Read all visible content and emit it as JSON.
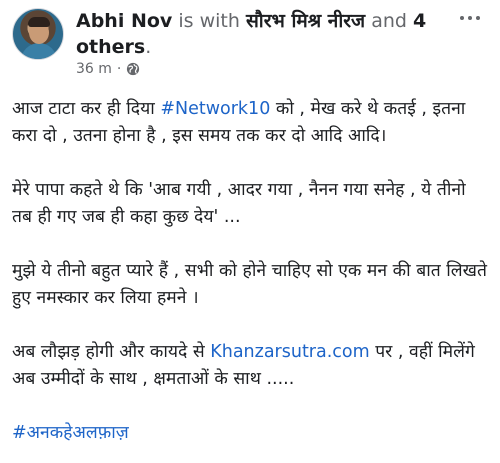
{
  "post": {
    "author": "Abhi Nov",
    "with_text": "is with",
    "tagged_person": "सौरभ मिश्र नीरज",
    "and_text": "and",
    "others": "4 others",
    "period": ".",
    "time": "36 m",
    "dot": "·",
    "privacy_icon": "globe-icon",
    "more_icon": "more-options-icon"
  },
  "body": {
    "p1_a": "आज टाटा कर ही दिया ",
    "p1_hashtag": "#Network10",
    "p1_b": " को , मेख करे थे कतई , इतना करा दो , उतना होना है , इस समय तक कर दो आदि आदि।",
    "p2": "मेरे पापा कहते थे कि 'आब गयी , आदर गया , नैनन गया सनेह , ये तीनो तब ही गए जब ही कहा कुछ देय' ...",
    "p3": "मुझे ये तीनो बहुत प्यारे हैं , सभी को होने चाहिए सो एक मन की बात लिखते हुए नमस्कार कर लिया हमने ।",
    "p4_a": "अब लौझड़ होगी और कायदे से ",
    "p4_link": "Khanzarsutra.com",
    "p4_b": " पर , वहीं मिलेंगे अब उम्मीदों के साथ , क्षमताओं के साथ .....",
    "hashtag_final": "#अनकहेअलफ़ाज़"
  },
  "colors": {
    "link": "#1d64c8",
    "muted": "#65676b",
    "text": "#1c1e21"
  }
}
